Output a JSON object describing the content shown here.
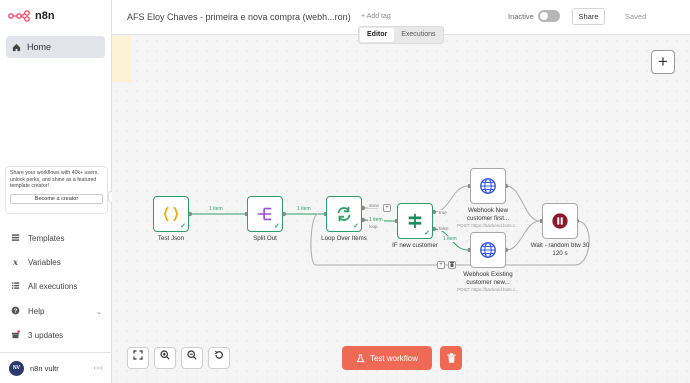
{
  "app": {
    "name": "n8n"
  },
  "sidebar": {
    "home_label": "Home",
    "promo_text": "Share your workflows with 40k+ users, unlock perks, and shine as a featured template creator!",
    "promo_button": "Become a creator",
    "collapse_glyph": "‹",
    "items": [
      {
        "label": "Templates",
        "icon": "templates-icon"
      },
      {
        "label": "Variables",
        "icon": "variables-icon"
      },
      {
        "label": "All executions",
        "icon": "executions-icon"
      },
      {
        "label": "Help",
        "icon": "help-icon"
      },
      {
        "label": "3 updates",
        "icon": "gift-icon"
      }
    ],
    "user": {
      "name": "n8n vultr",
      "initials": "NV"
    }
  },
  "header": {
    "title": "AFS Eloy Chaves - primeira e nova compra (webh...ron)",
    "add_tag": "+ Add tag",
    "status": "Inactive",
    "share": "Share",
    "saved": "Saved",
    "tabs": [
      "Editor",
      "Executions"
    ]
  },
  "nodes": {
    "test_json": {
      "label": "Test Json",
      "icon": "code-braces-icon"
    },
    "split_out": {
      "label": "Split Out",
      "icon": "split-icon"
    },
    "loop": {
      "label": "Loop Over Items",
      "icon": "loop-arrows-icon",
      "done": "done",
      "loop": "loop"
    },
    "if": {
      "label": "IF new customer",
      "icon": "if-branch-icon",
      "true_label": "true",
      "false_label": "false"
    },
    "webhook_new": {
      "label": "Webhook New customer first...",
      "sub": "POST: https://backend.bots.c...",
      "icon": "globe-icon"
    },
    "webhook_existing": {
      "label": "Webhook Existing customer new...",
      "sub": "POST: https://backend.bots.c...",
      "icon": "globe-icon"
    },
    "wait": {
      "label": "Wait - random btw 30 120 s",
      "icon": "pause-icon"
    }
  },
  "wires": {
    "w1": "1 item",
    "w2": "1 item",
    "w3": "1 item",
    "w4": "1 item"
  },
  "toolbar": {
    "fit": "fit-view-icon",
    "zoom_in": "zoom-in-icon",
    "zoom_out": "zoom-out-icon",
    "reset": "reset-zoom-icon",
    "test_workflow": "Test workflow"
  },
  "colors": {
    "accent": "#ef6a55",
    "success": "#2e9e6a",
    "wait_icon": "#8b1a2e",
    "webhook_icon": "#3a5bd9",
    "code_icon": "#f0a500",
    "split_icon": "#9b4fd1",
    "loop_icon": "#2e9e6a"
  }
}
